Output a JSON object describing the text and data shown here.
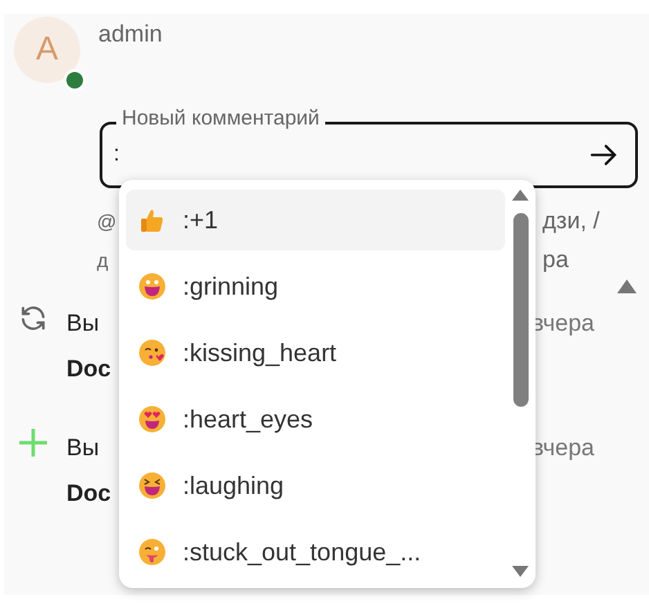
{
  "user": {
    "initial": "A",
    "name": "admin",
    "online": true
  },
  "comment_field": {
    "label": "Новый комментарий",
    "value": ":"
  },
  "hint": {
    "lines": [
      {
        "left": "@",
        "right": "дзи, /"
      },
      {
        "left": "д",
        "right": "ра"
      }
    ]
  },
  "activity": [
    {
      "kind": "refresh",
      "actor": "Вы",
      "time": "вчера",
      "doc": "Doc"
    },
    {
      "kind": "add",
      "actor": "Вы",
      "time": "вчера",
      "doc": "Doc"
    }
  ],
  "emoji_menu": {
    "items": [
      {
        "kind": "thumbs_up",
        "label": ":+1",
        "selected": true
      },
      {
        "kind": "grinning",
        "label": ":grinning",
        "selected": false
      },
      {
        "kind": "kissing_heart",
        "label": ":kissing_heart",
        "selected": false
      },
      {
        "kind": "heart_eyes",
        "label": ":heart_eyes",
        "selected": false
      },
      {
        "kind": "laughing",
        "label": ":laughing",
        "selected": false
      },
      {
        "kind": "tongue_wink",
        "label": ":stuck_out_tongue_...",
        "selected": false
      }
    ]
  }
}
